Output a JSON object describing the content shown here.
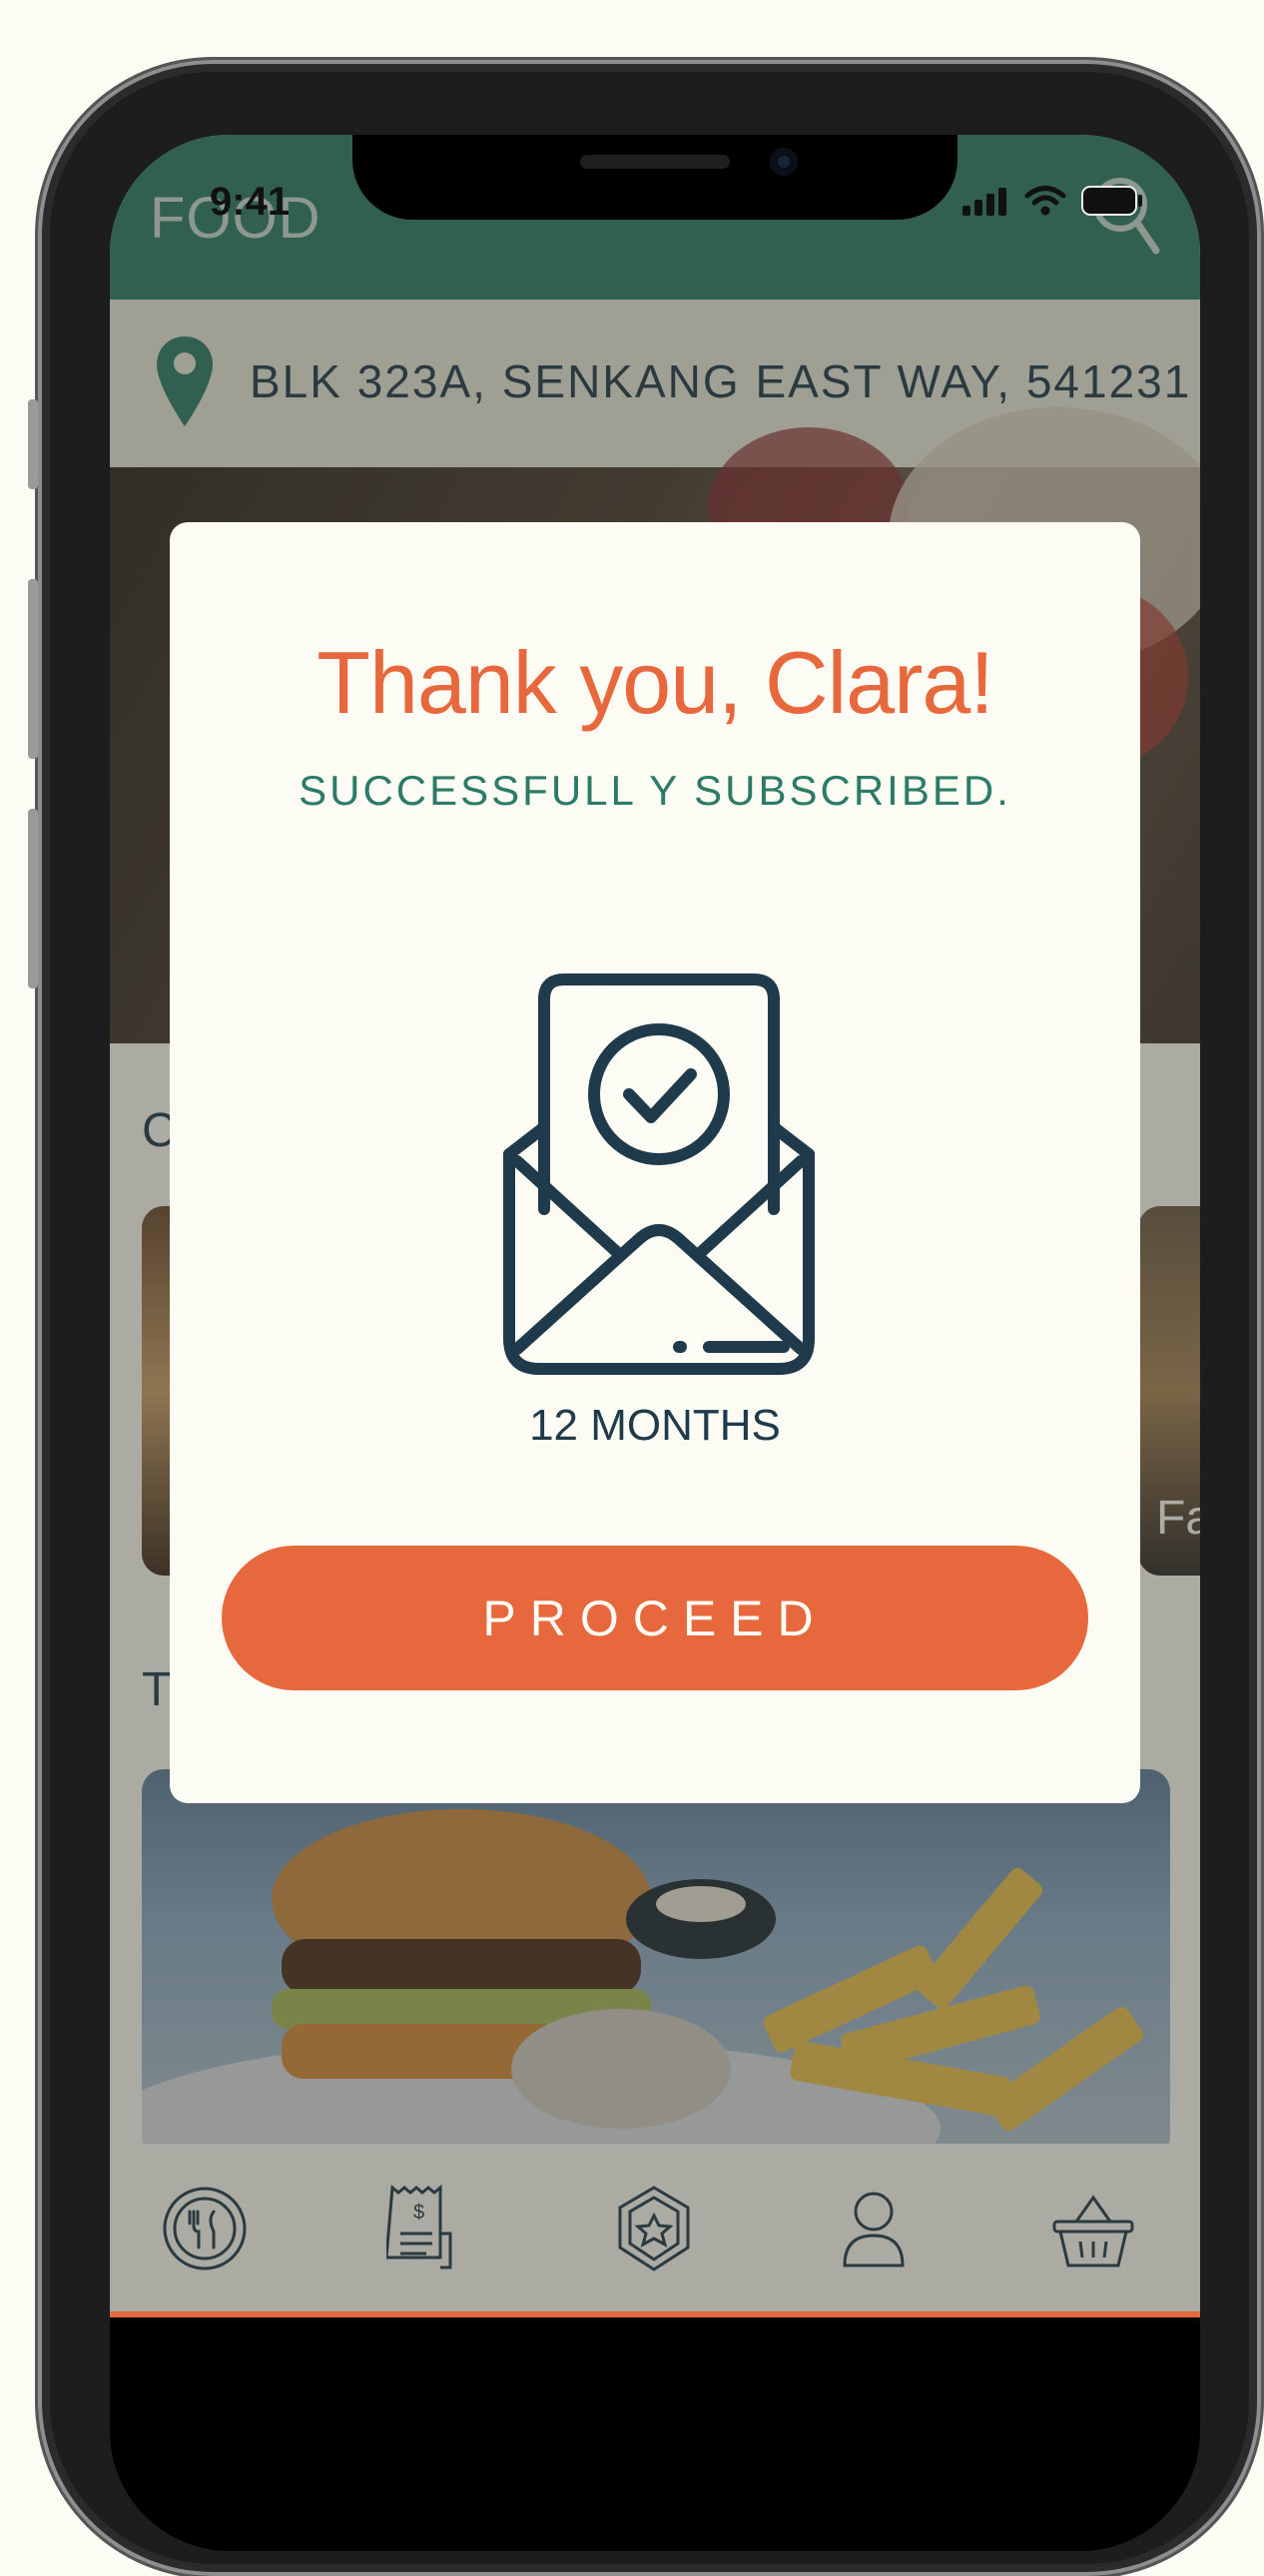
{
  "status_bar": {
    "time": "9:41"
  },
  "header": {
    "brand": "FOOD"
  },
  "address": {
    "text": "BLK 323A, SENKANG EAST WAY, 541231"
  },
  "background_sections": {
    "section1_initial": "C",
    "section2_initial": "T",
    "card_right_partial": "Fa"
  },
  "modal": {
    "title": "Thank you, Clara!",
    "subtitle": "SUCCESSFULL  Y SUBSCRIBED.",
    "duration": "12 MONTHS",
    "proceed_label": "PROCEED"
  },
  "tabbar": {
    "items": [
      {
        "icon": "dining-icon"
      },
      {
        "icon": "receipt-icon"
      },
      {
        "icon": "rewards-badge-icon"
      },
      {
        "icon": "profile-icon"
      },
      {
        "icon": "basket-icon"
      }
    ]
  },
  "colors": {
    "primary_green": "#2b7b66",
    "accent_orange": "#e8683d",
    "navy": "#1f3a4a",
    "cream": "#fcfcf4"
  }
}
